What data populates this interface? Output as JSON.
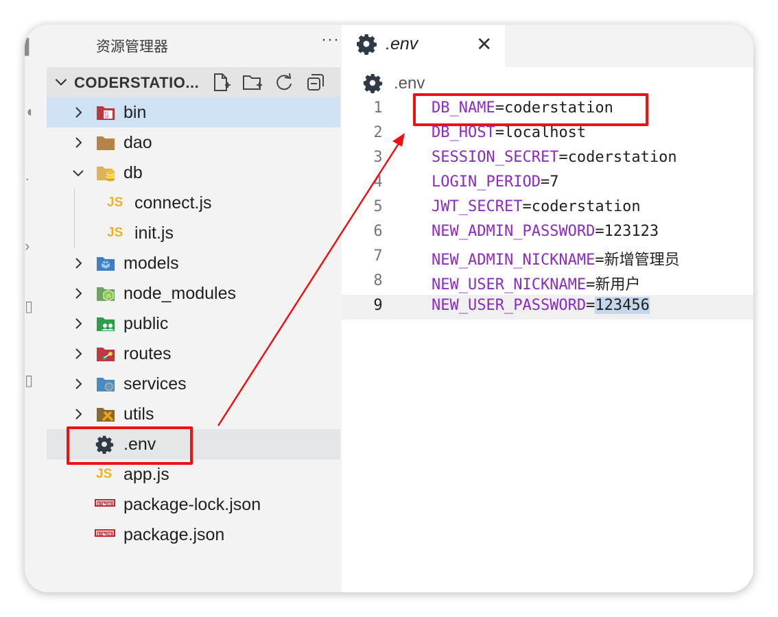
{
  "sidebar": {
    "title": "资源管理器",
    "more": "···",
    "folder_title": "CODERSTATIO...",
    "items": [
      {
        "label": "bin",
        "type": "folder",
        "icon": "binary-folder-icon"
      },
      {
        "label": "dao",
        "type": "folder",
        "icon": "folder-icon"
      },
      {
        "label": "db",
        "type": "folder-open",
        "icon": "database-folder-icon"
      },
      {
        "label": "connect.js",
        "type": "js"
      },
      {
        "label": "init.js",
        "type": "js"
      },
      {
        "label": "models",
        "type": "folder",
        "icon": "models-folder-icon"
      },
      {
        "label": "node_modules",
        "type": "folder",
        "icon": "node-folder-icon"
      },
      {
        "label": "public",
        "type": "folder",
        "icon": "public-folder-icon"
      },
      {
        "label": "routes",
        "type": "folder",
        "icon": "routes-folder-icon"
      },
      {
        "label": "services",
        "type": "folder",
        "icon": "services-folder-icon"
      },
      {
        "label": "utils",
        "type": "folder",
        "icon": "utils-folder-icon"
      },
      {
        "label": ".env",
        "type": "env"
      },
      {
        "label": "app.js",
        "type": "js"
      },
      {
        "label": "package-lock.json",
        "type": "npm"
      },
      {
        "label": "package.json",
        "type": "npm"
      }
    ]
  },
  "editor": {
    "tab_label": ".env",
    "tab_close": "✕",
    "breadcrumb": ".env",
    "lines": [
      {
        "num": "1",
        "key": "DB_NAME",
        "eq": "=",
        "value": "coderstation"
      },
      {
        "num": "2",
        "key": "DB_HOST",
        "eq": "=",
        "value": "localhost"
      },
      {
        "num": "3",
        "key": "SESSION_SECRET",
        "eq": "=",
        "value": "coderstation"
      },
      {
        "num": "4",
        "key": "LOGIN_PERIOD",
        "eq": "=",
        "value": "7"
      },
      {
        "num": "5",
        "key": "JWT_SECRET",
        "eq": "=",
        "value": "coderstation"
      },
      {
        "num": "6",
        "key": "NEW_ADMIN_PASSWORD",
        "eq": "=",
        "value": "123123"
      },
      {
        "num": "7",
        "key": "NEW_ADMIN_NICKNAME",
        "eq": "=",
        "value": "新增管理员"
      },
      {
        "num": "8",
        "key": "NEW_USER_NICKNAME",
        "eq": "=",
        "value": "新用户"
      },
      {
        "num": "9",
        "key": "NEW_USER_PASSWORD",
        "eq": "=",
        "value": "123456"
      }
    ]
  },
  "colors": {
    "key": "#8a2bc2",
    "annotation_red": "#ee1111",
    "selected_row": "#cfe2f3"
  }
}
